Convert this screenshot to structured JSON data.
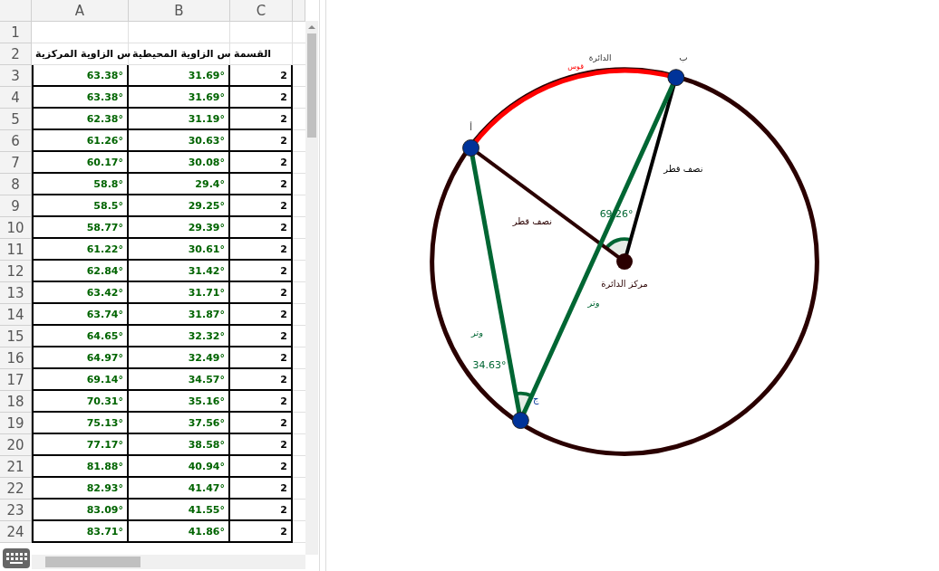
{
  "spreadsheet": {
    "columns": [
      "A",
      "B",
      "C"
    ],
    "rows": [
      {
        "number": "1",
        "cells": []
      },
      {
        "number": "2",
        "kind": "header",
        "cells": [
          "س الزاوية المركزية",
          "س الزاوية المحيطية",
          "القسمة"
        ]
      },
      {
        "number": "3",
        "kind": "data",
        "cells": [
          "63.38°",
          "31.69°",
          "2"
        ]
      },
      {
        "number": "4",
        "kind": "data",
        "cells": [
          "63.38°",
          "31.69°",
          "2"
        ]
      },
      {
        "number": "5",
        "kind": "data",
        "cells": [
          "62.38°",
          "31.19°",
          "2"
        ]
      },
      {
        "number": "6",
        "kind": "data",
        "cells": [
          "61.26°",
          "30.63°",
          "2"
        ]
      },
      {
        "number": "7",
        "kind": "data",
        "cells": [
          "60.17°",
          "30.08°",
          "2"
        ]
      },
      {
        "number": "8",
        "kind": "data",
        "cells": [
          "58.8°",
          "29.4°",
          "2"
        ]
      },
      {
        "number": "9",
        "kind": "data",
        "cells": [
          "58.5°",
          "29.25°",
          "2"
        ]
      },
      {
        "number": "10",
        "kind": "data",
        "cells": [
          "58.77°",
          "29.39°",
          "2"
        ]
      },
      {
        "number": "11",
        "kind": "data",
        "cells": [
          "61.22°",
          "30.61°",
          "2"
        ]
      },
      {
        "number": "12",
        "kind": "data",
        "cells": [
          "62.84°",
          "31.42°",
          "2"
        ]
      },
      {
        "number": "13",
        "kind": "data",
        "cells": [
          "63.42°",
          "31.71°",
          "2"
        ]
      },
      {
        "number": "14",
        "kind": "data",
        "cells": [
          "63.74°",
          "31.87°",
          "2"
        ]
      },
      {
        "number": "15",
        "kind": "data",
        "cells": [
          "64.65°",
          "32.32°",
          "2"
        ]
      },
      {
        "number": "16",
        "kind": "data",
        "cells": [
          "64.97°",
          "32.49°",
          "2"
        ]
      },
      {
        "number": "17",
        "kind": "data",
        "cells": [
          "69.14°",
          "34.57°",
          "2"
        ]
      },
      {
        "number": "18",
        "kind": "data",
        "cells": [
          "70.31°",
          "35.16°",
          "2"
        ]
      },
      {
        "number": "19",
        "kind": "data",
        "cells": [
          "75.13°",
          "37.56°",
          "2"
        ]
      },
      {
        "number": "20",
        "kind": "data",
        "cells": [
          "77.17°",
          "38.58°",
          "2"
        ]
      },
      {
        "number": "21",
        "kind": "data",
        "cells": [
          "81.88°",
          "40.94°",
          "2"
        ]
      },
      {
        "number": "22",
        "kind": "data",
        "cells": [
          "82.93°",
          "41.47°",
          "2"
        ]
      },
      {
        "number": "23",
        "kind": "data",
        "cells": [
          "83.09°",
          "41.55°",
          "2"
        ]
      },
      {
        "number": "24",
        "kind": "data",
        "cells": [
          "83.71°",
          "41.86°",
          "2"
        ]
      }
    ]
  },
  "geometry": {
    "points": [
      {
        "label": "أ"
      },
      {
        "label": "ب"
      },
      {
        "label": "ج"
      }
    ],
    "center_label": "مركز الدائرة",
    "arc_labels": [
      "الدائرة",
      "قوس"
    ],
    "radius_labels": [
      "نصف قطر",
      "نصف قطر"
    ],
    "chord_labels": [
      "وتر",
      "وتر"
    ],
    "central_angle": "69.26°",
    "inscribed_angle": "34.63°"
  }
}
